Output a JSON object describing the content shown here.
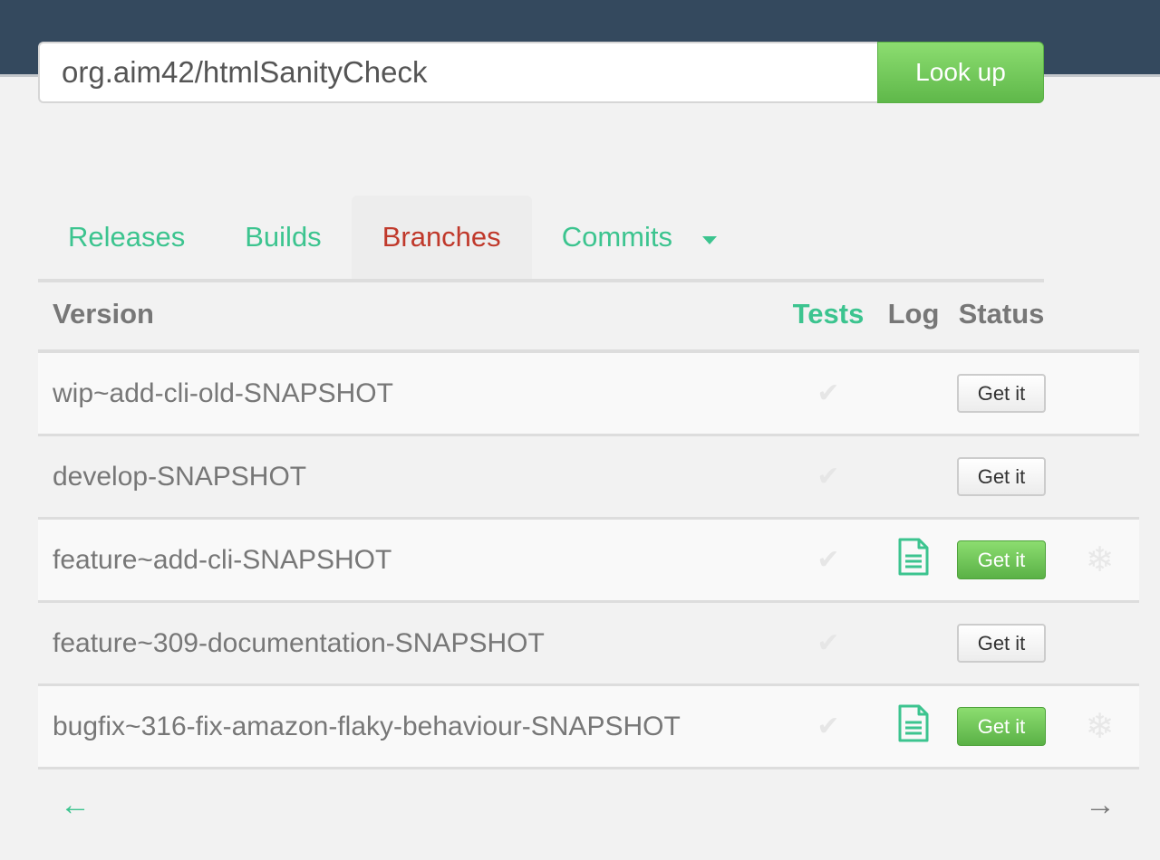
{
  "search": {
    "value": "org.aim42/htmlSanityCheck",
    "button_label": "Look up"
  },
  "tabs": [
    {
      "label": "Releases",
      "active": false
    },
    {
      "label": "Builds",
      "active": false
    },
    {
      "label": "Branches",
      "active": true
    },
    {
      "label": "Commits",
      "active": false
    }
  ],
  "colors": {
    "accent": "#3cc48f",
    "active_tab": "#c0392b",
    "header_bar": "#34495e",
    "button_green": "#5fb84a"
  },
  "table": {
    "headers": {
      "version": "Version",
      "tests": "Tests",
      "log": "Log",
      "status": "Status"
    },
    "rows": [
      {
        "version": "wip~add-cli-old-SNAPSHOT",
        "tests_icon": "check-icon",
        "has_log": false,
        "status_label": "Get it",
        "status_style": "plain",
        "snapshot_icon": false
      },
      {
        "version": "develop-SNAPSHOT",
        "tests_icon": "check-icon",
        "has_log": false,
        "status_label": "Get it",
        "status_style": "plain",
        "snapshot_icon": false
      },
      {
        "version": "feature~add-cli-SNAPSHOT",
        "tests_icon": "check-icon",
        "has_log": true,
        "status_label": "Get it",
        "status_style": "green",
        "snapshot_icon": true
      },
      {
        "version": "feature~309-documentation-SNAPSHOT",
        "tests_icon": "check-icon",
        "has_log": false,
        "status_label": "Get it",
        "status_style": "plain",
        "snapshot_icon": false
      },
      {
        "version": "bugfix~316-fix-amazon-flaky-behaviour-SNAPSHOT",
        "tests_icon": "check-icon",
        "has_log": true,
        "status_label": "Get it",
        "status_style": "green",
        "snapshot_icon": true
      }
    ]
  },
  "pager": {
    "prev": "←",
    "next": "→"
  },
  "icons": {
    "check": "✔",
    "snowflake": "❄"
  }
}
